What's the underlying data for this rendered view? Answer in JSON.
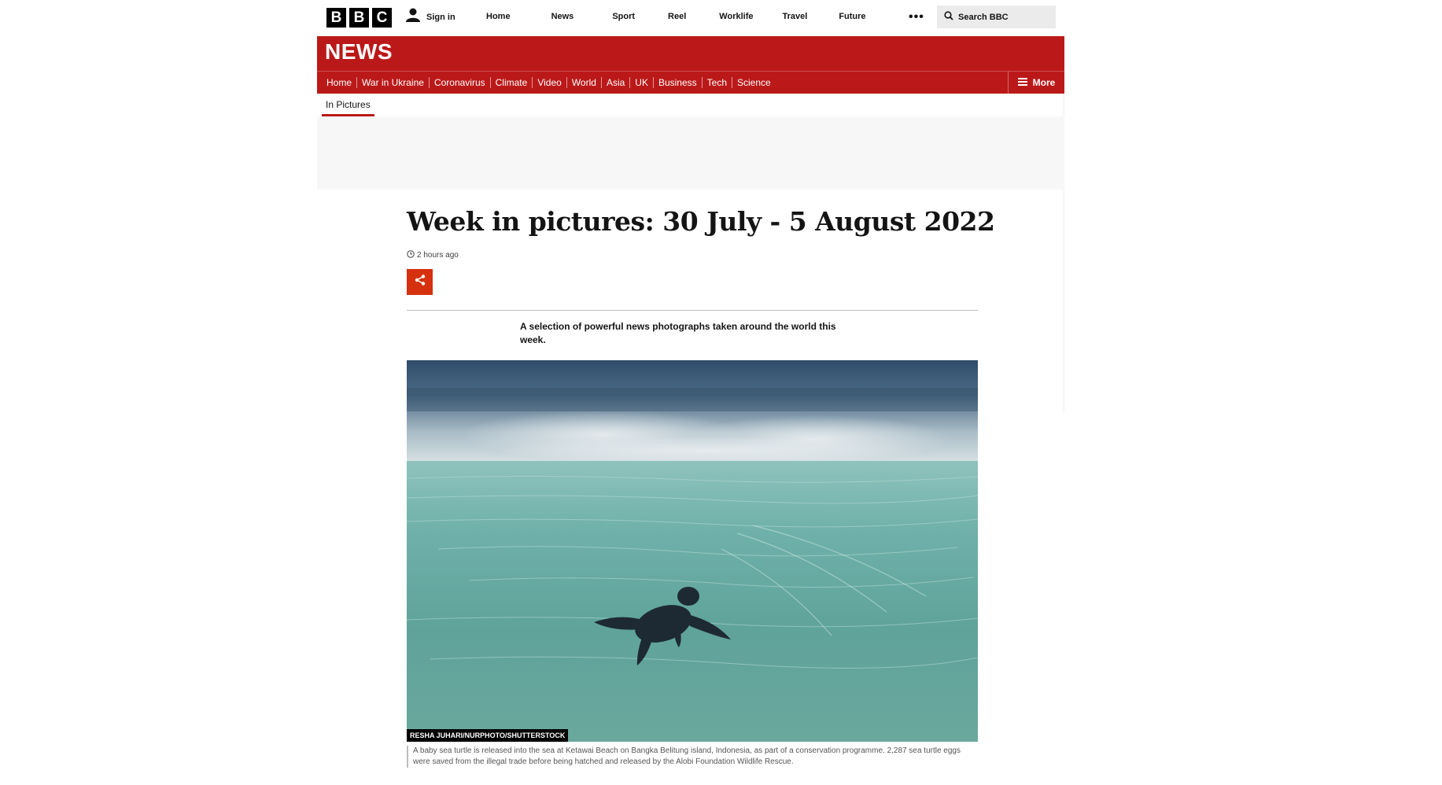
{
  "topbar": {
    "logo_letters": [
      "B",
      "B",
      "C"
    ],
    "signin_label": "Sign in",
    "nav": [
      "Home",
      "News",
      "Sport",
      "Reel",
      "Worklife",
      "Travel",
      "Future"
    ],
    "more_dots": "•••",
    "search_label": "Search BBC"
  },
  "news": {
    "title": "NEWS",
    "nav": [
      "Home",
      "War in Ukraine",
      "Coronavirus",
      "Climate",
      "Video",
      "World",
      "Asia",
      "UK",
      "Business",
      "Tech",
      "Science"
    ],
    "more_label": "More",
    "brand_color": "#bb1919"
  },
  "subnav": {
    "label": "In Pictures"
  },
  "article": {
    "headline": "Week in pictures: 30 July - 5 August 2022",
    "timestamp": "2 hours ago",
    "intro": "A selection of powerful news photographs taken around the world this week.",
    "share_color": "#d6310f"
  },
  "photo": {
    "credit": "RESHA JUHARI/NURPHOTO/SHUTTERSTOCK",
    "caption": "A baby sea turtle is released into the sea at Ketawai Beach on Bangka Belitung island, Indonesia, as part of a conservation programme. 2,287 sea turtle eggs were saved from the illegal trade before being hatched and released by the Alobi Foundation Wildlife Rescue."
  },
  "icons": {
    "user": "user-icon",
    "search": "search-icon",
    "menu": "hamburger-icon",
    "share": "share-icon",
    "clock": "clock-icon"
  }
}
